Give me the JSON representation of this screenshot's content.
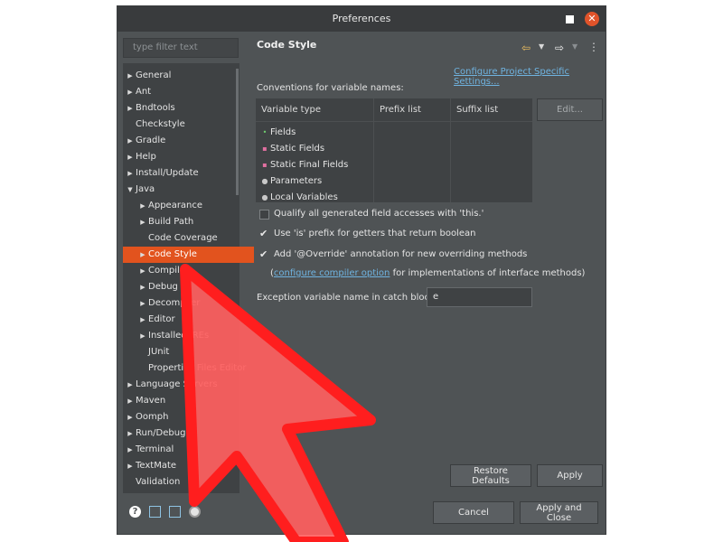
{
  "window": {
    "title": "Preferences"
  },
  "filter": {
    "placeholder": "type filter text"
  },
  "tree": [
    {
      "label": "General",
      "twisty": "▶"
    },
    {
      "label": "Ant",
      "twisty": "▶"
    },
    {
      "label": "Bndtools",
      "twisty": "▶"
    },
    {
      "label": "Checkstyle",
      "twisty": ""
    },
    {
      "label": "Gradle",
      "twisty": "▶"
    },
    {
      "label": "Help",
      "twisty": "▶"
    },
    {
      "label": "Install/Update",
      "twisty": "▶"
    },
    {
      "label": "Java",
      "twisty": "▼"
    },
    {
      "label": "Appearance",
      "twisty": "▶"
    },
    {
      "label": "Build Path",
      "twisty": "▶"
    },
    {
      "label": "Code Coverage",
      "twisty": ""
    },
    {
      "label": "Code Style",
      "twisty": "▶",
      "selected": true
    },
    {
      "label": "Compiler",
      "twisty": "▶"
    },
    {
      "label": "Debug",
      "twisty": "▶"
    },
    {
      "label": "Decompiler",
      "twisty": "▶"
    },
    {
      "label": "Editor",
      "twisty": "▶"
    },
    {
      "label": "Installed JREs",
      "twisty": "▶"
    },
    {
      "label": "JUnit",
      "twisty": ""
    },
    {
      "label": "Properties Files Editor",
      "twisty": ""
    },
    {
      "label": "Language Servers",
      "twisty": "▶"
    },
    {
      "label": "Maven",
      "twisty": "▶"
    },
    {
      "label": "Oomph",
      "twisty": "▶"
    },
    {
      "label": "Run/Debug",
      "twisty": "▶"
    },
    {
      "label": "Terminal",
      "twisty": "▶"
    },
    {
      "label": "TextMate",
      "twisty": "▶"
    },
    {
      "label": "Validation",
      "twisty": ""
    }
  ],
  "page": {
    "title": "Code Style",
    "configure_link": "Configure Project Specific Settings...",
    "conventions_label": "Conventions for variable names:",
    "table": {
      "headers": [
        "Variable type",
        "Prefix list",
        "Suffix list"
      ],
      "rows": [
        {
          "icon": "•",
          "label": "Fields",
          "color": "#6fcf6f"
        },
        {
          "icon": "▪",
          "label": "Static Fields",
          "color": "#e070a0"
        },
        {
          "icon": "▪",
          "label": "Static Final Fields",
          "color": "#e070a0"
        },
        {
          "icon": "●",
          "label": "Parameters",
          "color": "#c8c8c8"
        },
        {
          "icon": "●",
          "label": "Local Variables",
          "color": "#c8c8c8"
        }
      ]
    },
    "edit_button": "Edit...",
    "options": [
      {
        "label": "Qualify all generated field accesses with 'this.'",
        "checked": false
      },
      {
        "label": "Use 'is' prefix for getters that return boolean",
        "checked": true
      },
      {
        "label": "Add '@Override' annotation for new overriding methods",
        "checked": true
      }
    ],
    "note_prefix": "(",
    "note_link": "configure compiler option",
    "note_suffix": " for implementations of interface methods)",
    "exception_label": "Exception variable name in catch blocks:",
    "exception_value": "e"
  },
  "buttons": {
    "restore_defaults": "Restore Defaults",
    "apply": "Apply",
    "cancel": "Cancel",
    "apply_close": "Apply and Close"
  },
  "icons": {
    "back": "back-arrow-icon",
    "forward": "forward-arrow-icon",
    "menu": "kebab-menu-icon",
    "help": "help-icon",
    "import": "import-icon",
    "export": "export-icon",
    "record": "record-icon"
  },
  "colors": {
    "accent": "#e2531e",
    "link": "#6fb3e0",
    "cursor": "#ff2a2a"
  }
}
